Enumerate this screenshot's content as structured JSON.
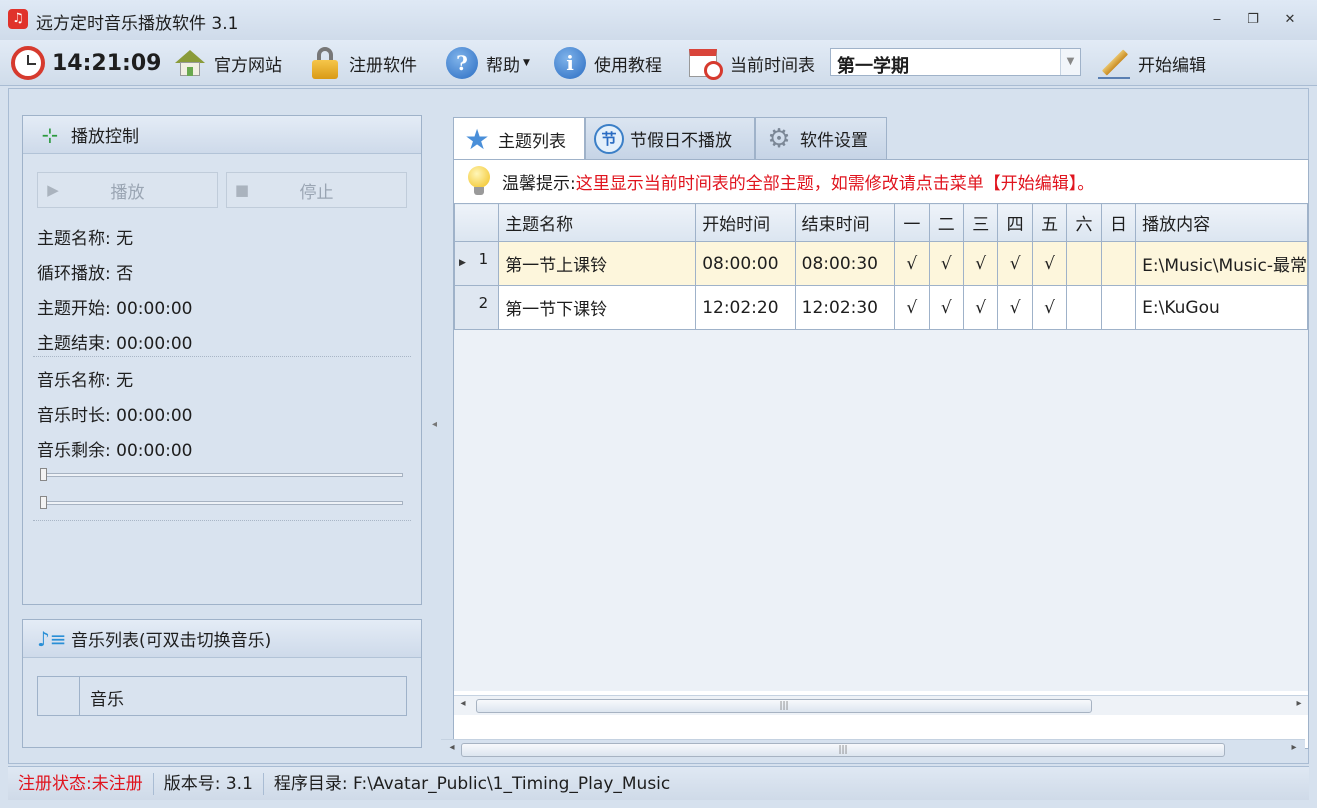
{
  "window": {
    "title": "远方定时音乐播放软件 3.1",
    "app_icon": "music-note-icon",
    "minimize": "‒",
    "restore": "❐",
    "close": "✕"
  },
  "toolbar": {
    "clock": "14:21:09",
    "website": "官方网站",
    "register": "注册软件",
    "help": "帮助",
    "tutorial": "使用教程",
    "schedule_label": "当前时间表",
    "schedule_value": "第一学期",
    "edit": "开始编辑"
  },
  "playback": {
    "title": "播放控制",
    "play": "播放",
    "stop": "停止",
    "theme_name_label": "主题名称:",
    "theme_name": "无",
    "loop_label": "循环播放:",
    "loop": "否",
    "theme_start_label": "主题开始:",
    "theme_start": "00:00:00",
    "theme_end_label": "主题结束:",
    "theme_end": "00:00:00",
    "music_name_label": "音乐名称:",
    "music_name": "无",
    "music_length_label": "音乐时长:",
    "music_length": "00:00:00",
    "music_remaining_label": "音乐剩余:",
    "music_remaining": "00:00:00",
    "progress_level": 0,
    "volume_level": 0
  },
  "music_list": {
    "title": "音乐列表(可双击切换音乐)",
    "column": "音乐"
  },
  "tabs": [
    {
      "label": "主题列表",
      "icon": "star-icon"
    },
    {
      "label": "节假日不播放",
      "icon": "holiday-icon",
      "icon_text": "节"
    },
    {
      "label": "软件设置",
      "icon": "gear-icon"
    }
  ],
  "tip": {
    "label": "温馨提示:",
    "text": "这里显示当前时间表的全部主题，如需修改请点击菜单【开始编辑】。"
  },
  "table": {
    "columns": [
      "主题名称",
      "开始时间",
      "结束时间",
      "一",
      "二",
      "三",
      "四",
      "五",
      "六",
      "日",
      "播放内容"
    ],
    "rows": [
      {
        "num": "1",
        "name": "第一节上课铃",
        "start": "08:00:00",
        "end": "08:00:30",
        "d1": "√",
        "d2": "√",
        "d3": "√",
        "d4": "√",
        "d5": "√",
        "d6": "",
        "d7": "",
        "content": "E:\\Music\\Music-最常"
      },
      {
        "num": "2",
        "name": "第一节下课铃",
        "start": "12:02:20",
        "end": "12:02:30",
        "d1": "√",
        "d2": "√",
        "d3": "√",
        "d4": "√",
        "d5": "√",
        "d6": "",
        "d7": "",
        "content": "E:\\KuGou"
      }
    ]
  },
  "status": {
    "reg_label": "注册状态:",
    "reg_value": "未注册",
    "version": "版本号: 3.1",
    "dir": "程序目录: F:\\Avatar_Public\\1_Timing_Play_Music"
  },
  "colors": {
    "accent_red": "#e0141e",
    "selected_row": "#fdf6dc",
    "frame": "#d6e1ee"
  }
}
